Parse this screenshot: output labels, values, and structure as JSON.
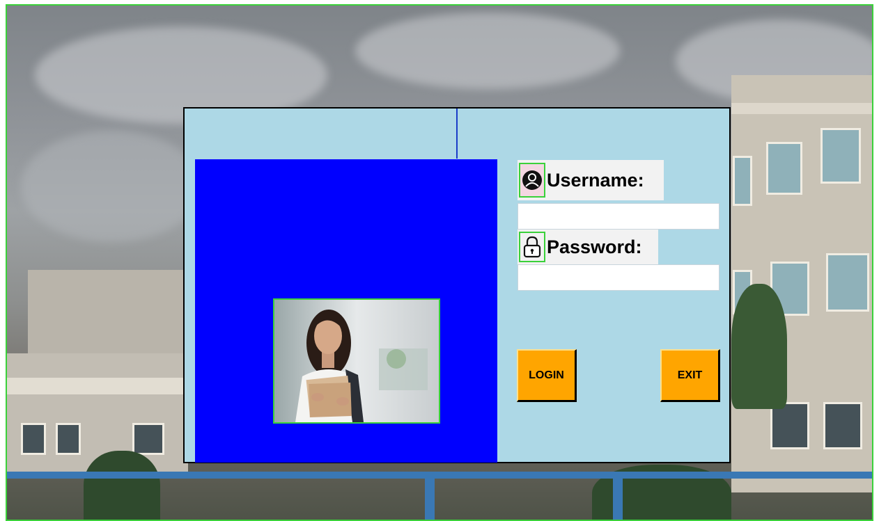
{
  "login": {
    "username_label": "Username:",
    "password_label": "Password:",
    "username_value": "",
    "password_value": "",
    "login_button": "LOGIN",
    "exit_button": "EXIT"
  },
  "icons": {
    "username": "user-avatar-icon",
    "password": "padlock-icon"
  },
  "colors": {
    "dialog_background": "#add8e6",
    "left_panel": "#0000ff",
    "button": "#ffa500",
    "frame_border": "#3ad13a"
  }
}
